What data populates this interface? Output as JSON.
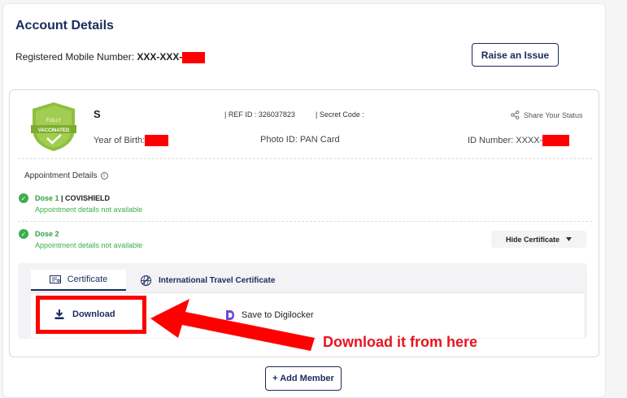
{
  "header": {
    "title": "Account Details",
    "mobile_label": "Registered Mobile Number:",
    "mobile_value": "XXX-XXX-",
    "raise_issue_label": "Raise an Issue"
  },
  "beneficiary": {
    "badge_top": "FULLY",
    "badge_bottom": "VACCINATED",
    "name": "S",
    "ref_id": "| REF ID : 326037823",
    "secret_code": "| Secret Code :",
    "share_label": "Share Your Status",
    "year_of_birth_label": "Year of Birth:",
    "photo_id": "Photo ID: PAN Card",
    "id_number_label": "ID Number: XXXX-"
  },
  "appointment": {
    "title": "Appointment Details",
    "doses": [
      {
        "label": "Dose 1",
        "vaccine": "| COVISHIELD",
        "note": "Appointment details not available"
      },
      {
        "label": "Dose 2",
        "vaccine": "",
        "note": "Appointment details not available"
      }
    ],
    "hide_certificate_label": "Hide Certificate"
  },
  "certificate": {
    "tabs": [
      {
        "label": "Certificate",
        "active": true
      },
      {
        "label": "International Travel Certificate",
        "active": false
      }
    ],
    "download_label": "Download",
    "digilocker_label": "Save to Digilocker"
  },
  "annotation": {
    "text": "Download it from here",
    "color": "#e8141b"
  },
  "footer": {
    "add_member_label": "+ Add Member"
  },
  "colors": {
    "primary": "#1b2b5e",
    "success": "#3cae4a",
    "redaction": "#ff0000"
  },
  "icons": [
    "shield-badge-icon",
    "share-icon",
    "info-icon",
    "check-circle-icon",
    "chevron-down-icon",
    "certificate-icon",
    "globe-travel-icon",
    "download-icon",
    "digilocker-icon"
  ]
}
